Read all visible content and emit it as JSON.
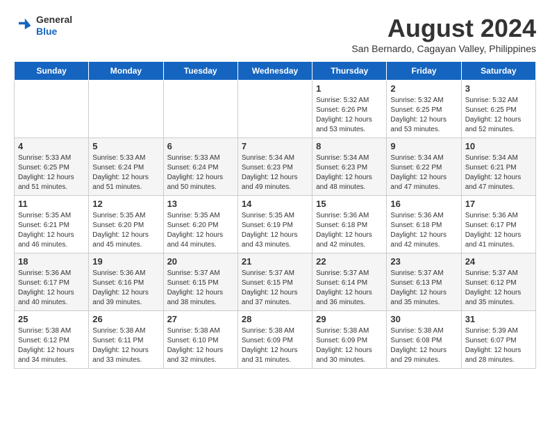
{
  "header": {
    "logo_general": "General",
    "logo_blue": "Blue",
    "month_year": "August 2024",
    "location": "San Bernardo, Cagayan Valley, Philippines"
  },
  "days": [
    "Sunday",
    "Monday",
    "Tuesday",
    "Wednesday",
    "Thursday",
    "Friday",
    "Saturday"
  ],
  "weeks": [
    {
      "cells": [
        {
          "day": "",
          "info": ""
        },
        {
          "day": "",
          "info": ""
        },
        {
          "day": "",
          "info": ""
        },
        {
          "day": "",
          "info": ""
        },
        {
          "day": "1",
          "info": "Sunrise: 5:32 AM\nSunset: 6:26 PM\nDaylight: 12 hours\nand 53 minutes."
        },
        {
          "day": "2",
          "info": "Sunrise: 5:32 AM\nSunset: 6:25 PM\nDaylight: 12 hours\nand 53 minutes."
        },
        {
          "day": "3",
          "info": "Sunrise: 5:32 AM\nSunset: 6:25 PM\nDaylight: 12 hours\nand 52 minutes."
        }
      ]
    },
    {
      "cells": [
        {
          "day": "4",
          "info": "Sunrise: 5:33 AM\nSunset: 6:25 PM\nDaylight: 12 hours\nand 51 minutes."
        },
        {
          "day": "5",
          "info": "Sunrise: 5:33 AM\nSunset: 6:24 PM\nDaylight: 12 hours\nand 51 minutes."
        },
        {
          "day": "6",
          "info": "Sunrise: 5:33 AM\nSunset: 6:24 PM\nDaylight: 12 hours\nand 50 minutes."
        },
        {
          "day": "7",
          "info": "Sunrise: 5:34 AM\nSunset: 6:23 PM\nDaylight: 12 hours\nand 49 minutes."
        },
        {
          "day": "8",
          "info": "Sunrise: 5:34 AM\nSunset: 6:23 PM\nDaylight: 12 hours\nand 48 minutes."
        },
        {
          "day": "9",
          "info": "Sunrise: 5:34 AM\nSunset: 6:22 PM\nDaylight: 12 hours\nand 47 minutes."
        },
        {
          "day": "10",
          "info": "Sunrise: 5:34 AM\nSunset: 6:21 PM\nDaylight: 12 hours\nand 47 minutes."
        }
      ]
    },
    {
      "cells": [
        {
          "day": "11",
          "info": "Sunrise: 5:35 AM\nSunset: 6:21 PM\nDaylight: 12 hours\nand 46 minutes."
        },
        {
          "day": "12",
          "info": "Sunrise: 5:35 AM\nSunset: 6:20 PM\nDaylight: 12 hours\nand 45 minutes."
        },
        {
          "day": "13",
          "info": "Sunrise: 5:35 AM\nSunset: 6:20 PM\nDaylight: 12 hours\nand 44 minutes."
        },
        {
          "day": "14",
          "info": "Sunrise: 5:35 AM\nSunset: 6:19 PM\nDaylight: 12 hours\nand 43 minutes."
        },
        {
          "day": "15",
          "info": "Sunrise: 5:36 AM\nSunset: 6:18 PM\nDaylight: 12 hours\nand 42 minutes."
        },
        {
          "day": "16",
          "info": "Sunrise: 5:36 AM\nSunset: 6:18 PM\nDaylight: 12 hours\nand 42 minutes."
        },
        {
          "day": "17",
          "info": "Sunrise: 5:36 AM\nSunset: 6:17 PM\nDaylight: 12 hours\nand 41 minutes."
        }
      ]
    },
    {
      "cells": [
        {
          "day": "18",
          "info": "Sunrise: 5:36 AM\nSunset: 6:17 PM\nDaylight: 12 hours\nand 40 minutes."
        },
        {
          "day": "19",
          "info": "Sunrise: 5:36 AM\nSunset: 6:16 PM\nDaylight: 12 hours\nand 39 minutes."
        },
        {
          "day": "20",
          "info": "Sunrise: 5:37 AM\nSunset: 6:15 PM\nDaylight: 12 hours\nand 38 minutes."
        },
        {
          "day": "21",
          "info": "Sunrise: 5:37 AM\nSunset: 6:15 PM\nDaylight: 12 hours\nand 37 minutes."
        },
        {
          "day": "22",
          "info": "Sunrise: 5:37 AM\nSunset: 6:14 PM\nDaylight: 12 hours\nand 36 minutes."
        },
        {
          "day": "23",
          "info": "Sunrise: 5:37 AM\nSunset: 6:13 PM\nDaylight: 12 hours\nand 35 minutes."
        },
        {
          "day": "24",
          "info": "Sunrise: 5:37 AM\nSunset: 6:12 PM\nDaylight: 12 hours\nand 35 minutes."
        }
      ]
    },
    {
      "cells": [
        {
          "day": "25",
          "info": "Sunrise: 5:38 AM\nSunset: 6:12 PM\nDaylight: 12 hours\nand 34 minutes."
        },
        {
          "day": "26",
          "info": "Sunrise: 5:38 AM\nSunset: 6:11 PM\nDaylight: 12 hours\nand 33 minutes."
        },
        {
          "day": "27",
          "info": "Sunrise: 5:38 AM\nSunset: 6:10 PM\nDaylight: 12 hours\nand 32 minutes."
        },
        {
          "day": "28",
          "info": "Sunrise: 5:38 AM\nSunset: 6:09 PM\nDaylight: 12 hours\nand 31 minutes."
        },
        {
          "day": "29",
          "info": "Sunrise: 5:38 AM\nSunset: 6:09 PM\nDaylight: 12 hours\nand 30 minutes."
        },
        {
          "day": "30",
          "info": "Sunrise: 5:38 AM\nSunset: 6:08 PM\nDaylight: 12 hours\nand 29 minutes."
        },
        {
          "day": "31",
          "info": "Sunrise: 5:39 AM\nSunset: 6:07 PM\nDaylight: 12 hours\nand 28 minutes."
        }
      ]
    }
  ]
}
